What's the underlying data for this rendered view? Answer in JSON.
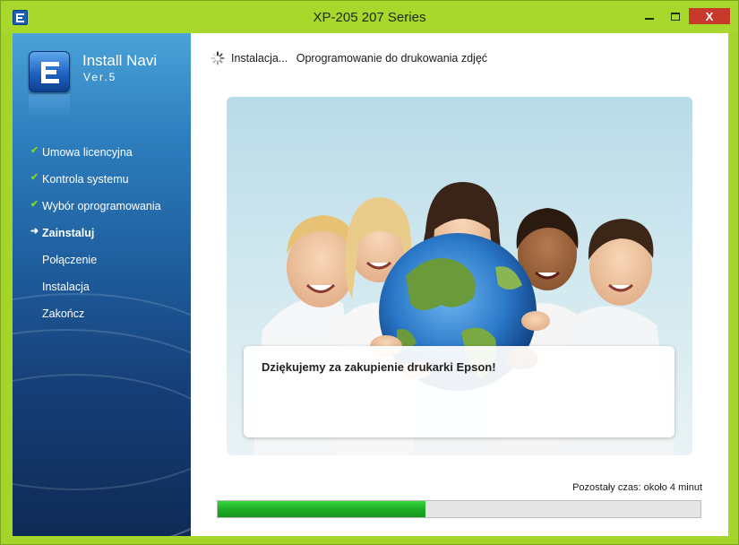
{
  "window": {
    "title": "XP-205 207 Series",
    "minimize_icon": "minimize-icon",
    "maximize_icon": "maximize-icon",
    "close_label": "X"
  },
  "sidebar": {
    "brand_name": "Install Navi",
    "brand_version": "Ver.5",
    "logo_icon": "epson-e-logo-icon",
    "steps": [
      {
        "label": "Umowa licencyjna",
        "state": "done",
        "icon": "check-icon"
      },
      {
        "label": "Kontrola systemu",
        "state": "done",
        "icon": "check-icon"
      },
      {
        "label": "Wybór oprogramowania",
        "state": "done",
        "icon": "check-icon"
      },
      {
        "label": "Zainstaluj",
        "state": "current",
        "icon": "arrow-right-icon"
      },
      {
        "label": "Połączenie",
        "state": "pending",
        "icon": ""
      },
      {
        "label": "Instalacja",
        "state": "pending",
        "icon": ""
      },
      {
        "label": "Zakończ",
        "state": "pending",
        "icon": ""
      }
    ]
  },
  "main": {
    "status": "Instalacja...",
    "status_detail": "Oprogramowanie do drukowania zdjęć",
    "spinner_icon": "loading-spinner-icon",
    "hero_image": "children-holding-globe-photo",
    "message": "Dziękujemy za zakupienie drukarki Epson!",
    "time_remaining": "Pozostały czas: około 4 minut",
    "progress": 0.43
  },
  "colors": {
    "window_frame": "#a6d52a",
    "sidebar_top": "#4aa2d8",
    "sidebar_bottom": "#0f2a55",
    "check": "#7ed321",
    "progress_fill": "#1fae26"
  }
}
